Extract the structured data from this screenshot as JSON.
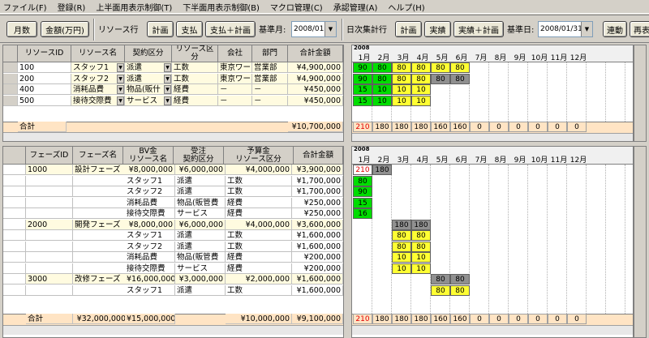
{
  "menu": [
    "ファイル(F)",
    "登録(R)",
    "上半面用表示制御(T)",
    "下半面用表示制御(B)",
    "マクロ管理(C)",
    "承認管理(A)",
    "ヘルプ(H)"
  ],
  "toolbar": {
    "btn_count": "月数",
    "btn_amount": "金額(万円)",
    "label_resource": "リソース行",
    "btn_plan": "計画",
    "btn_pay": "支払",
    "btn_pay_plan": "支払＋計画",
    "label_base_month": "基準月:",
    "base_month": "2008/01",
    "label_daily": "日次集計行",
    "btn_plan2": "計画",
    "btn_actual": "実績",
    "btn_actual_plan": "実績＋計画",
    "label_base_date": "基準日:",
    "base_date": "2008/01/31",
    "btn_link": "連動",
    "btn_redisp": "再表"
  },
  "upper": {
    "headers": [
      "リソースID",
      "リソース名",
      "契約区分",
      "リソース区分",
      "会社",
      "部門",
      "合計金額"
    ],
    "rows": [
      {
        "id": "100",
        "name": "スタッフ1",
        "contract": "派遣",
        "rtype": "工数",
        "company": "東京ワー",
        "dept": "営業部",
        "total": "¥4,900,000"
      },
      {
        "id": "200",
        "name": "スタッフ2",
        "contract": "派遣",
        "rtype": "工数",
        "company": "東京ワー",
        "dept": "営業部",
        "total": "¥4,900,000"
      },
      {
        "id": "400",
        "name": "消耗品費",
        "contract": "物品(販什",
        "rtype": "経費",
        "company": "－",
        "dept": "－",
        "total": "¥450,000"
      },
      {
        "id": "500",
        "name": "接待交際費",
        "contract": "サービス",
        "rtype": "経費",
        "company": "－",
        "dept": "－",
        "total": "¥450,000"
      }
    ],
    "total_label": "合計",
    "total_value": "¥10,700,000",
    "year": "2008",
    "months": [
      "1月",
      "2月",
      "3月",
      "4月",
      "5月",
      "6月",
      "7月",
      "8月",
      "9月",
      "10月",
      "11月",
      "12月"
    ],
    "cal": [
      [
        [
          "90",
          "g"
        ],
        [
          "80",
          "g"
        ],
        [
          "80",
          "y"
        ],
        [
          "80",
          "y"
        ],
        [
          "80",
          "y"
        ],
        [
          "80",
          "y"
        ]
      ],
      [
        [
          "90",
          "g"
        ],
        [
          "80",
          "g"
        ],
        [
          "80",
          "y"
        ],
        [
          "80",
          "y"
        ],
        [
          "80",
          "gr"
        ],
        [
          "80",
          "gr"
        ]
      ],
      [
        [
          "15",
          "g"
        ],
        [
          "10",
          "g"
        ],
        [
          "10",
          "y"
        ],
        [
          "10",
          "y"
        ],
        null,
        null
      ],
      [
        [
          "15",
          "g"
        ],
        [
          "10",
          "g"
        ],
        [
          "10",
          "y"
        ],
        [
          "10",
          "y"
        ],
        null,
        null
      ]
    ],
    "cal_totals": [
      "210",
      "180",
      "180",
      "180",
      "160",
      "160",
      "0",
      "0",
      "0",
      "0",
      "0",
      "0"
    ]
  },
  "lower": {
    "headers": [
      "フェーズID",
      "フェーズ名",
      "BV金\nリソース名",
      "受注\n契約区分",
      "予算金\nリソース区分",
      "合計金額"
    ],
    "rows": [
      {
        "c0": "1000",
        "c1": "設計フェーズ",
        "c2": "¥8,000,000",
        "c3": "¥6,000,000",
        "c4": "¥4,000,000",
        "c5": "¥3,900,000",
        "phase": true
      },
      {
        "c0": "",
        "c1": "",
        "c2": "スタッフ1",
        "c3": "派遣",
        "c4": "工数",
        "c5": "¥1,700,000"
      },
      {
        "c0": "",
        "c1": "",
        "c2": "スタッフ2",
        "c3": "派遣",
        "c4": "工数",
        "c5": "¥1,700,000"
      },
      {
        "c0": "",
        "c1": "",
        "c2": "消耗品費",
        "c3": "物品(販管費",
        "c4": "経費",
        "c5": "¥250,000"
      },
      {
        "c0": "",
        "c1": "",
        "c2": "接待交際費",
        "c3": "サービス",
        "c4": "経費",
        "c5": "¥250,000"
      },
      {
        "c0": "2000",
        "c1": "開発フェーズ",
        "c2": "¥8,000,000",
        "c3": "¥6,000,000",
        "c4": "¥4,000,000",
        "c5": "¥3,600,000",
        "phase": true
      },
      {
        "c0": "",
        "c1": "",
        "c2": "スタッフ1",
        "c3": "派遣",
        "c4": "工数",
        "c5": "¥1,600,000"
      },
      {
        "c0": "",
        "c1": "",
        "c2": "スタッフ2",
        "c3": "派遣",
        "c4": "工数",
        "c5": "¥1,600,000"
      },
      {
        "c0": "",
        "c1": "",
        "c2": "消耗品費",
        "c3": "物品(販管費",
        "c4": "経費",
        "c5": "¥200,000"
      },
      {
        "c0": "",
        "c1": "",
        "c2": "接待交際費",
        "c3": "サービス",
        "c4": "経費",
        "c5": "¥200,000"
      },
      {
        "c0": "3000",
        "c1": "改修フェーズ",
        "c2": "¥16,000,000",
        "c3": "¥3,000,000",
        "c4": "¥2,000,000",
        "c5": "¥1,600,000",
        "phase": true
      },
      {
        "c0": "",
        "c1": "",
        "c2": "スタッフ1",
        "c3": "派遣",
        "c4": "工数",
        "c5": "¥1,600,000"
      }
    ],
    "total_label": "合計",
    "total_c2": "¥32,000,000",
    "total_c3": "¥15,000,000",
    "total_c4": "¥10,000,000",
    "total_c5": "¥9,100,000",
    "year": "2008",
    "months": [
      "1月",
      "2月",
      "3月",
      "4月",
      "5月",
      "6月",
      "7月",
      "8月",
      "9月",
      "10月",
      "11月",
      "12月"
    ],
    "cal": [
      [
        [
          "210",
          "red"
        ],
        [
          "180",
          "gr"
        ]
      ],
      [
        [
          "80",
          "g"
        ]
      ],
      [
        [
          "90",
          "g"
        ]
      ],
      [
        [
          "15",
          "g"
        ]
      ],
      [
        [
          "16",
          "g"
        ]
      ],
      [
        null,
        null,
        [
          "180",
          "gr"
        ],
        [
          "180",
          "gr"
        ]
      ],
      [
        null,
        null,
        [
          "80",
          "y"
        ],
        [
          "80",
          "y"
        ]
      ],
      [
        null,
        null,
        [
          "80",
          "y"
        ],
        [
          "80",
          "y"
        ]
      ],
      [
        null,
        null,
        [
          "10",
          "y"
        ],
        [
          "10",
          "y"
        ]
      ],
      [
        null,
        null,
        [
          "10",
          "y"
        ],
        [
          "10",
          "y"
        ]
      ],
      [
        null,
        null,
        null,
        null,
        [
          "80",
          "gr"
        ],
        [
          "80",
          "gr"
        ]
      ],
      [
        null,
        null,
        null,
        null,
        [
          "80",
          "y"
        ],
        [
          "80",
          "y"
        ]
      ]
    ],
    "cal_totals": [
      "210",
      "180",
      "180",
      "180",
      "160",
      "160",
      "0",
      "0",
      "0",
      "0",
      "0",
      "0"
    ]
  }
}
